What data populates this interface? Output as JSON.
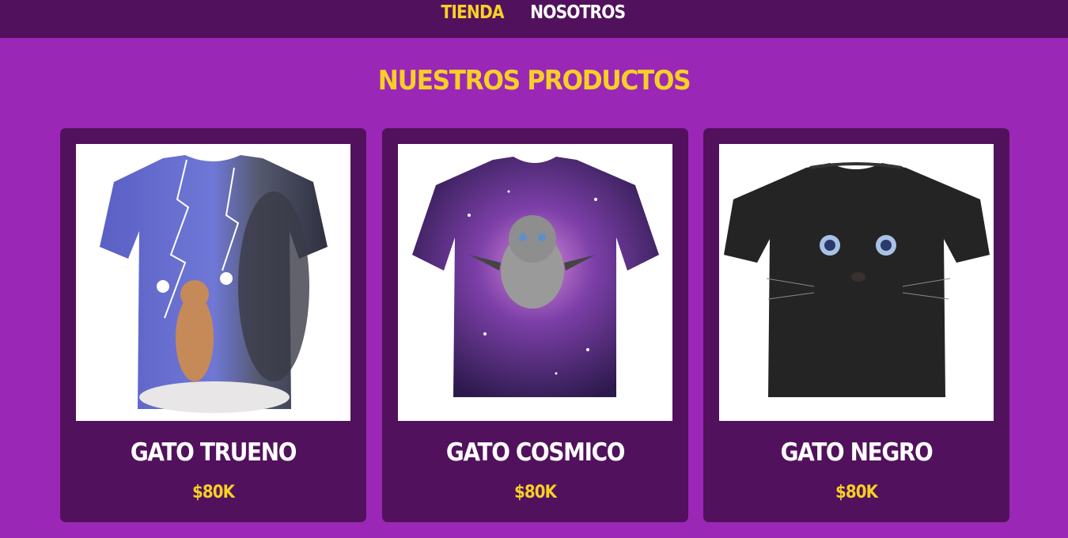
{
  "nav": {
    "items": [
      {
        "label": "TIENDA",
        "active": true
      },
      {
        "label": "NOSOTROS",
        "active": false
      }
    ]
  },
  "main": {
    "title": "NUESTROS PRODUCTOS"
  },
  "products": [
    {
      "name": "GATO TRUENO",
      "price": "$80K",
      "image": "thunder-cat-tshirt"
    },
    {
      "name": "GATO COSMICO",
      "price": "$80K",
      "image": "cosmic-cat-tshirt"
    },
    {
      "name": "GATO NEGRO",
      "price": "$80K",
      "image": "black-cat-tshirt"
    }
  ],
  "colors": {
    "background": "#9b27b6",
    "nav_bg": "#52115c",
    "card_bg": "#52115c",
    "accent": "#f5d026",
    "text": "#ffffff"
  }
}
